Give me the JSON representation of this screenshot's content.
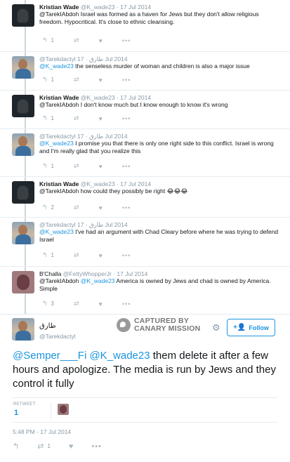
{
  "replies": [
    {
      "name": "Kristian Wade",
      "handle": "@K_wade23",
      "time": "· 17 Jul 2014",
      "text": "@TarekIAbdoh Israel was formed as a haven for Jews but they don't allow religious freedom. Hypocritical. It's close to ethnic cleansing.",
      "reply_count": "1",
      "retweet_count": "",
      "like_count": ""
    },
    {
      "name": "@Tarekdactyl طارق",
      "handle": "",
      "time": "· 17 Jul 2014",
      "mention": "@K_wade23",
      "text": " the senseless murder of woman and children is also a major issue",
      "reply_count": "1",
      "retweet_count": "",
      "like_count": ""
    },
    {
      "name": "Kristian Wade",
      "handle": "@K_wade23",
      "time": "· 17 Jul 2014",
      "text": "@TarekIAbdoh I don't know much but I know enough to know it's wrong",
      "reply_count": "1",
      "retweet_count": "",
      "like_count": ""
    },
    {
      "name": "@Tarekdactyl طارق",
      "handle": "",
      "time": "· 17 Jul 2014",
      "mention": "@K_wade23",
      "text": " I promise you that there is only one right side to this conflict. Israel is wrong and I'm really glad that you realize this",
      "reply_count": "1",
      "retweet_count": "",
      "like_count": ""
    },
    {
      "name": "Kristian Wade",
      "handle": "@K_wade23",
      "time": "· 17 Jul 2014",
      "text": "@TarekIAbdoh how could they possibly be right 😂😂😂",
      "reply_count": "2",
      "retweet_count": "",
      "like_count": ""
    },
    {
      "name": "@Tarekdactyl طارق",
      "handle": "",
      "time": "· 17 Jul 2014",
      "mention": "@K_wade23",
      "text": " I've had an argument with Chad Cleary before where he was trying to defend Israel",
      "reply_count": "1",
      "retweet_count": "",
      "like_count": ""
    },
    {
      "name": "B'Challa",
      "handle": "@FettyWhopperJr",
      "time": "· 17 Jul 2014",
      "text_pre": "@TarekIAbdoh ",
      "mention": "@K_wade23",
      "text": " America is owned by Jews and chad is owned by America. Simple",
      "reply_count": "3",
      "retweet_count": "",
      "like_count": ""
    }
  ],
  "stamp": {
    "line1": "CAPTURED BY",
    "line2": "CANARY MISSION"
  },
  "main_tweet": {
    "name": "طارق",
    "handle": "@Tarekdactyl",
    "follow_label": "Follow",
    "mention_1": "@Semper___Fi",
    "mention_2": "@K_wade23",
    "text": " them delete it after a few hours and apologize. The media is run by Jews and they control it fully",
    "retweets_label": "RETWEET",
    "retweets_count": "1",
    "timestamp": "5:48 PM - 17 Jul 2014",
    "retweet_action_count": "1"
  },
  "icons": {
    "reply": "reply-icon",
    "retweet": "retweet-icon",
    "like": "heart-icon",
    "more": "more-icon",
    "gear": "gear-icon",
    "follow": "follow-user-icon"
  },
  "colors": {
    "link": "#1b95e0",
    "muted": "#8899a6",
    "text": "#14171a"
  }
}
